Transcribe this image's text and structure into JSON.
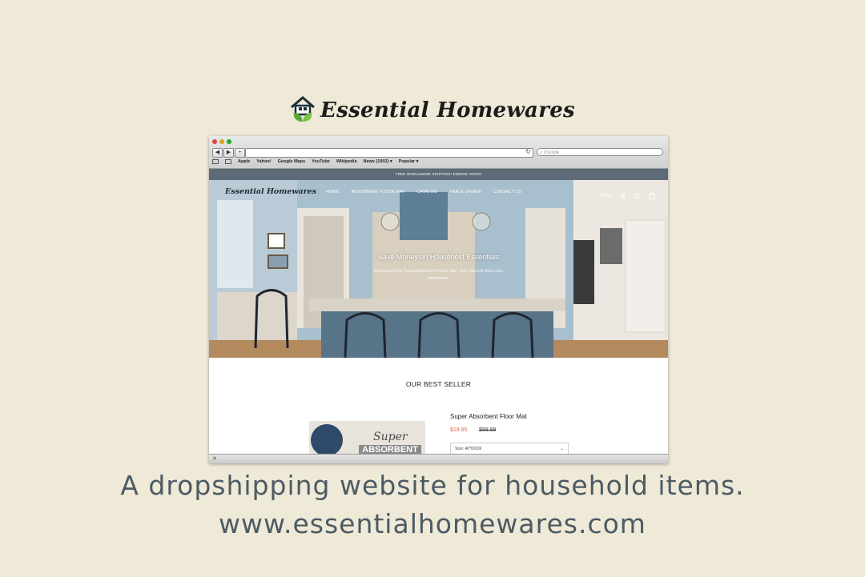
{
  "brand": {
    "name": "Essential Homewares",
    "icon": "house-leaf-logo-icon"
  },
  "browser": {
    "search_placeholder": "Google",
    "bookmarks": [
      "Apple",
      "Yahoo!",
      "Google Maps",
      "YouTube",
      "Wikipedia",
      "News (1002) ▾",
      "Popular ▾"
    ]
  },
  "site": {
    "announcement": "FREE WORLDWIDE SHIPPING! ENDING SOON!",
    "logo": "Essential Homewares",
    "nav": [
      "HOME",
      "ABSORBENT FLOOR MAT",
      "CATALOG",
      "TRACK ORDER",
      "CONTACT US"
    ],
    "currency": "USD",
    "hero": {
      "title": "Save Money on Household Essentials",
      "subtitle": "Introducing the Super Absorbent Floor Mat - they absorb that extra dampness"
    },
    "best_seller": {
      "heading": "OUR BEST SELLER",
      "product_name": "Super Absorbent Floor Mat",
      "price": "$19.95",
      "old_price": "$89.99",
      "size_label": "Size: 40*60CM",
      "image_text_1": "Super",
      "image_text_2": "ABSORBENT"
    }
  },
  "caption": {
    "line1": "A dropshipping website for household items.",
    "line2": "www.essentialhomewares.com"
  },
  "colors": {
    "background": "#efe9d8",
    "announcement_bar": "#5d6b78",
    "sale_price": "#d9644a",
    "caption_text": "#4c5b63"
  }
}
